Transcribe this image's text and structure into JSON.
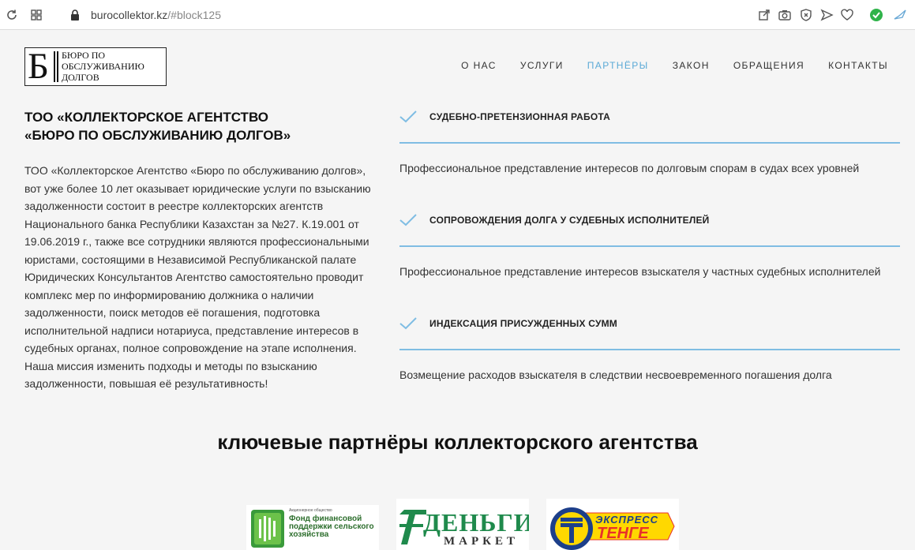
{
  "browser": {
    "domain": "burocollektor.kz",
    "path": "/#block125"
  },
  "logo": {
    "letter": "Б",
    "text": "БЮРО ПО\nОБСЛУЖИВАНИЮ\nДОЛГОВ"
  },
  "nav": [
    {
      "label": "О НАС",
      "active": false
    },
    {
      "label": "УСЛУГИ",
      "active": false
    },
    {
      "label": "ПАРТНЁРЫ",
      "active": true
    },
    {
      "label": "ЗАКОН",
      "active": false
    },
    {
      "label": "ОБРАЩЕНИЯ",
      "active": false
    },
    {
      "label": "КОНТАКТЫ",
      "active": false
    }
  ],
  "about": {
    "title_line1": "ТОО «КОЛЛЕКТОРСКОЕ АГЕНТСТВО",
    "title_line2": "«БЮРО ПО ОБСЛУЖИВАНИЮ ДОЛГОВ»",
    "paragraph": "ТОО «Коллекторское Агентство «Бюро по обслуживанию долгов», вот уже более 10 лет оказывает юридические услуги по взысканию задолженности состоит в реестре коллекторских агентств Национального банка Республики Казахстан за №27. К.19.001 от 19.06.2019 г., также все сотрудники являются профессиональными юристами, состоящими в Независимой Республиканской палате Юридических Консультантов Агентство самостоятельно проводит комплекс мер по информированию должника о наличии задолженности, поиск методов её погашения, подготовка исполнительной надписи нотариуса, представление интересов в судебных органах, полное сопровождение на этапе исполнения.",
    "mission": "Наша миссия изменить подходы и методы по взысканию задолженности, повышая её результативность!"
  },
  "services": [
    {
      "title": "СУДЕБНО-ПРЕТЕНЗИОННАЯ РАБОТА",
      "desc": "Профессиональное представление интересов по долговым спорам в судах всех уровней"
    },
    {
      "title": "СОПРОВОЖДЕНИЯ ДОЛГА У СУДЕБНЫХ ИСПОЛНИТЕЛЕЙ",
      "desc": "Профессиональное представление интересов взыскателя у частных судебных исполнителей"
    },
    {
      "title": "ИНДЕКСАЦИЯ ПРИСУЖДЕННЫХ СУММ",
      "desc": "Возмещение расходов взыскателя в следствии несвоевременного погашения долга"
    }
  ],
  "partners_title": "ключевые партнёры коллекторского агентства",
  "partners": [
    {
      "small": "Акционерное общество",
      "name": "Фонд финансовой поддержки сельского хозяйства",
      "color": "#3a9a3a"
    },
    {
      "name": "ДЕНЬГИ",
      "sub": "МАРКЕТ",
      "color": "#1f8a4c"
    },
    {
      "name": "ЭКСПРЕСС",
      "sub": "ТЕНГЕ",
      "color": "#e8312a",
      "bg": "#ffd800"
    }
  ],
  "accent": "#5aa9d6"
}
